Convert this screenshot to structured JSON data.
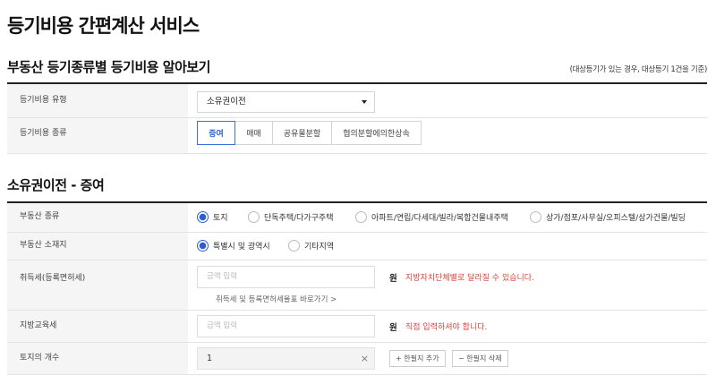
{
  "page": {
    "title": "등기비용 간편계산 서비스"
  },
  "lookup": {
    "title": "부동산 등기종류별 등기비용 알아보기",
    "note": "(대상등기가 있는 경우, 대상등기 1건을 기준)",
    "type_label": "등기비용 유형",
    "type_value": "소유권이전",
    "kind_label": "등기비용 종류",
    "kinds": [
      "증여",
      "매매",
      "공유물분할",
      "협의분할에의한상속"
    ],
    "kind_selected": "증여"
  },
  "detail": {
    "title": "소유권이전 - 증여",
    "property_label": "부동산 종류",
    "property_options": [
      "토지",
      "단독주택/다가구주택",
      "아파트/연립/다세대/빌라/복합건물내주택",
      "상가/점포/사무실/오피스텔/상가건물/빌딩"
    ],
    "property_selected": "토지",
    "location_label": "부동산 소재지",
    "location_options": [
      "특별시 및 광역시",
      "기타지역"
    ],
    "location_selected": "특별시 및 광역시",
    "acq_tax_label": "취득세(등록면허세)",
    "acq_tax_placeholder": "금액 입력",
    "acq_tax_unit": "원",
    "acq_tax_warn": "지방자치단체별로 달라질 수 있습니다.",
    "acq_tax_link": "취득세 및 등록면허세율표 바로가기 >",
    "edu_tax_label": "지방교육세",
    "edu_tax_placeholder": "금액 입력",
    "edu_tax_unit": "원",
    "edu_tax_warn": "직접 입력하셔야 합니다.",
    "land_count_label": "토지의 개수",
    "land_count_value": "1",
    "clear_symbol": "×",
    "add_button": "+ 한필지 추가",
    "remove_button": "− 한필지 삭제"
  }
}
